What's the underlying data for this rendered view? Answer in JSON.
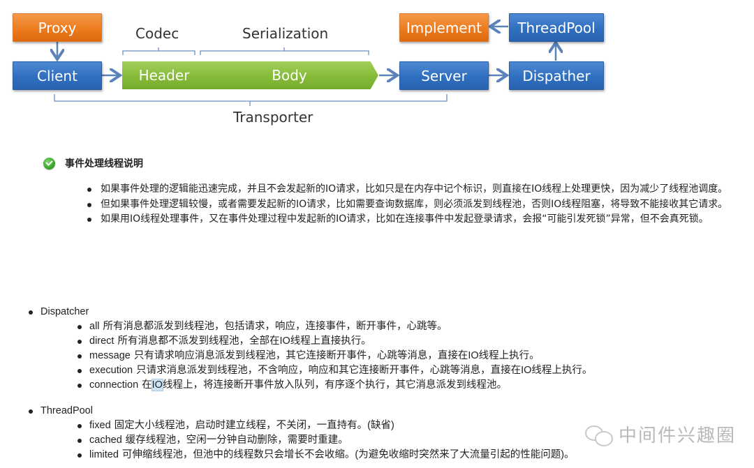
{
  "diagram": {
    "proxy": "Proxy",
    "client": "Client",
    "codec": "Codec",
    "header": "Header",
    "serialization": "Serialization",
    "body": "Body",
    "transporter": "Transporter",
    "server": "Server",
    "dispather": "Dispather",
    "threadpool": "ThreadPool",
    "implement": "Implement",
    "colors": {
      "orange": "#ec7c1f",
      "blue": "#2f6fc0",
      "green": "#86bb3a",
      "connector": "#5b82b9"
    }
  },
  "section": {
    "title": "事件处理线程说明",
    "icon": "check-circle-icon",
    "notes": [
      "如果事件处理的逻辑能迅速完成，并且不会发起新的IO请求，比如只是在内存中记个标识，则直接在IO线程上处理更快，因为减少了线程池调度。",
      "但如果事件处理逻辑较慢，或者需要发起新的IO请求，比如需要查询数据库，则必须派发到线程池，否则IO线程阻塞，将导致不能接收其它请求。",
      "如果用IO线程处理事件，又在事件处理过程中发起新的IO请求，比如在连接事件中发起登录请求，会报“可能引发死锁”异常，但不会真死锁。"
    ]
  },
  "dispatcher": {
    "title": "Dispatcher",
    "items": [
      {
        "key": "all",
        "text": "所有消息都派发到线程池，包括请求，响应，连接事件，断开事件，心跳等。"
      },
      {
        "key": "direct",
        "text": "所有消息都不派发到线程池，全部在IO线程上直接执行。"
      },
      {
        "key": "message",
        "text": "只有请求响应消息派发到线程池，其它连接断开事件，心跳等消息，直接在IO线程上执行。"
      },
      {
        "key": "execution",
        "text": "只请求消息派发到线程池，不含响应，响应和其它连接断开事件，心跳等消息，直接在IO线程上执行。"
      },
      {
        "key": "connection",
        "text_before": "在",
        "selected": "IO",
        "text_after": "线程上，将连接断开事件放入队列，有序逐个执行，其它消息派发到线程池。"
      }
    ]
  },
  "threadpool": {
    "title": "ThreadPool",
    "items": [
      {
        "key": "fixed",
        "text": "固定大小线程池，启动时建立线程，不关闭，一直持有。(缺省)"
      },
      {
        "key": "cached",
        "text": "缓存线程池，空闲一分钟自动删除，需要时重建。"
      },
      {
        "key": "limited",
        "text": "可伸缩线程池，但池中的线程数只会增长不会收缩。(为避免收缩时突然来了大流量引起的性能问题)。"
      }
    ]
  },
  "watermark": {
    "icon": "wechat-icon",
    "text": "中间件兴趣圈"
  }
}
